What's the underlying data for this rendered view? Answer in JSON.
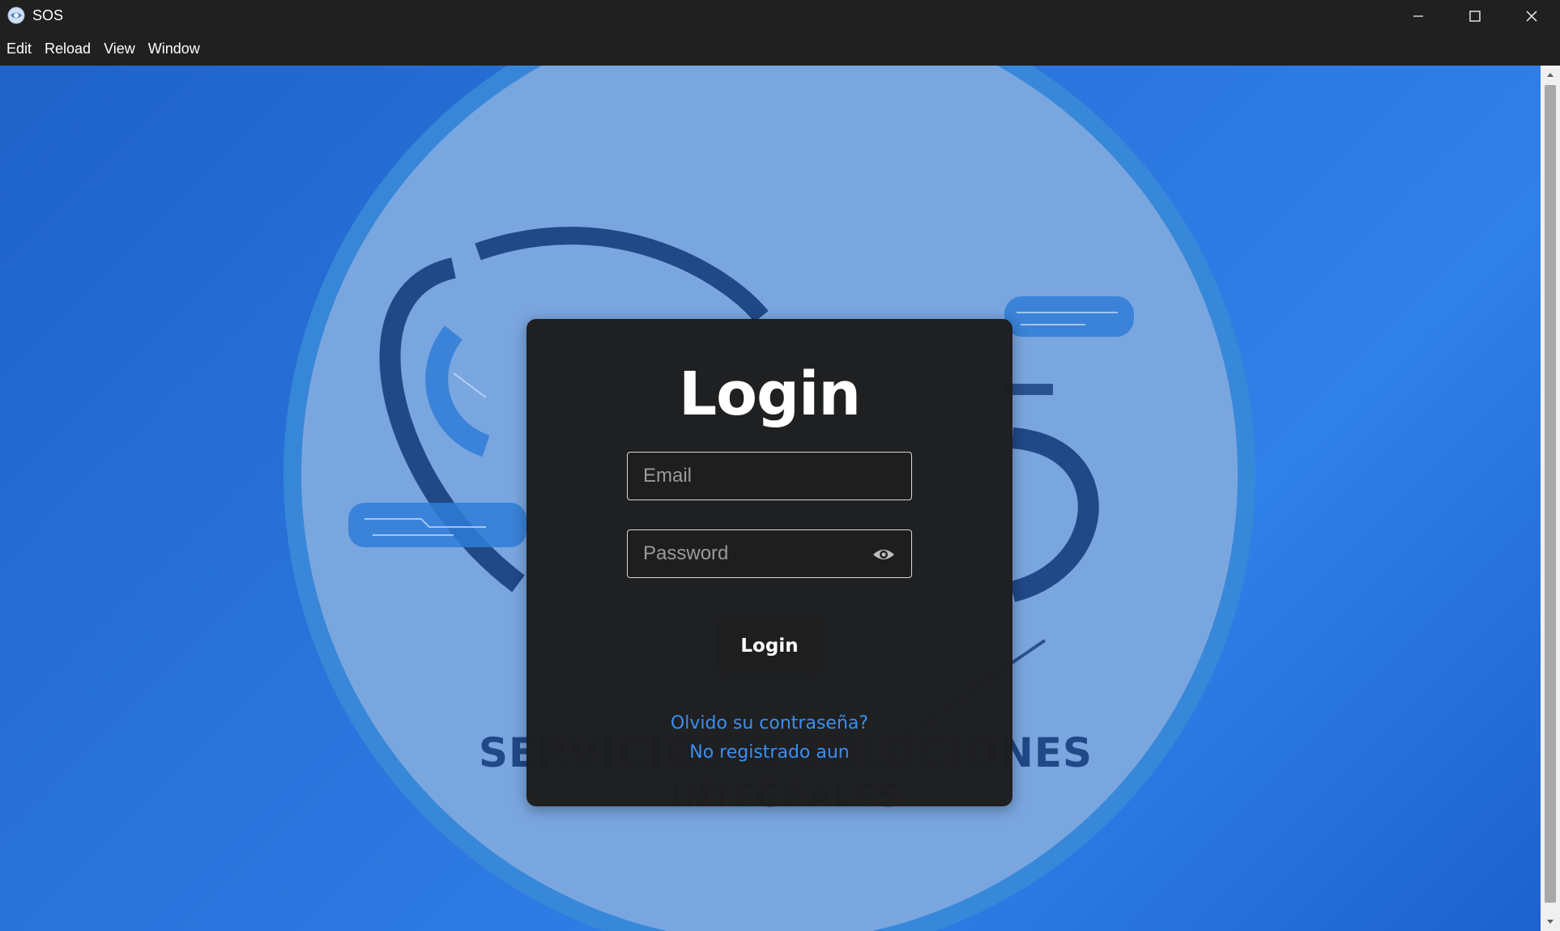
{
  "window": {
    "title": "SOS",
    "app_icon": "globe-icon",
    "controls": [
      "minimize-icon",
      "maximize-icon",
      "close-icon"
    ]
  },
  "menu": {
    "items": [
      {
        "label": "Edit"
      },
      {
        "label": "Reload"
      },
      {
        "label": "View"
      },
      {
        "label": "Window"
      }
    ]
  },
  "background": {
    "logo_line1": "SERVICIOS O SOLUCIONES",
    "logo_line2": "INTEGRALES",
    "colors": {
      "bg_blue": "#2a74dc",
      "circle": "#7aa6e0",
      "ring": "#3a8ad8",
      "logo_dark": "#173f7e"
    }
  },
  "login": {
    "title": "Login",
    "email_placeholder": "Email",
    "password_placeholder": "Password",
    "submit_label": "Login",
    "forgot_link": "Olvido su contraseña?",
    "register_link": "No registrado aun",
    "colors": {
      "card_bg": "#1e1e1e",
      "link": "#3b8ff0",
      "text": "#ffffff"
    }
  }
}
